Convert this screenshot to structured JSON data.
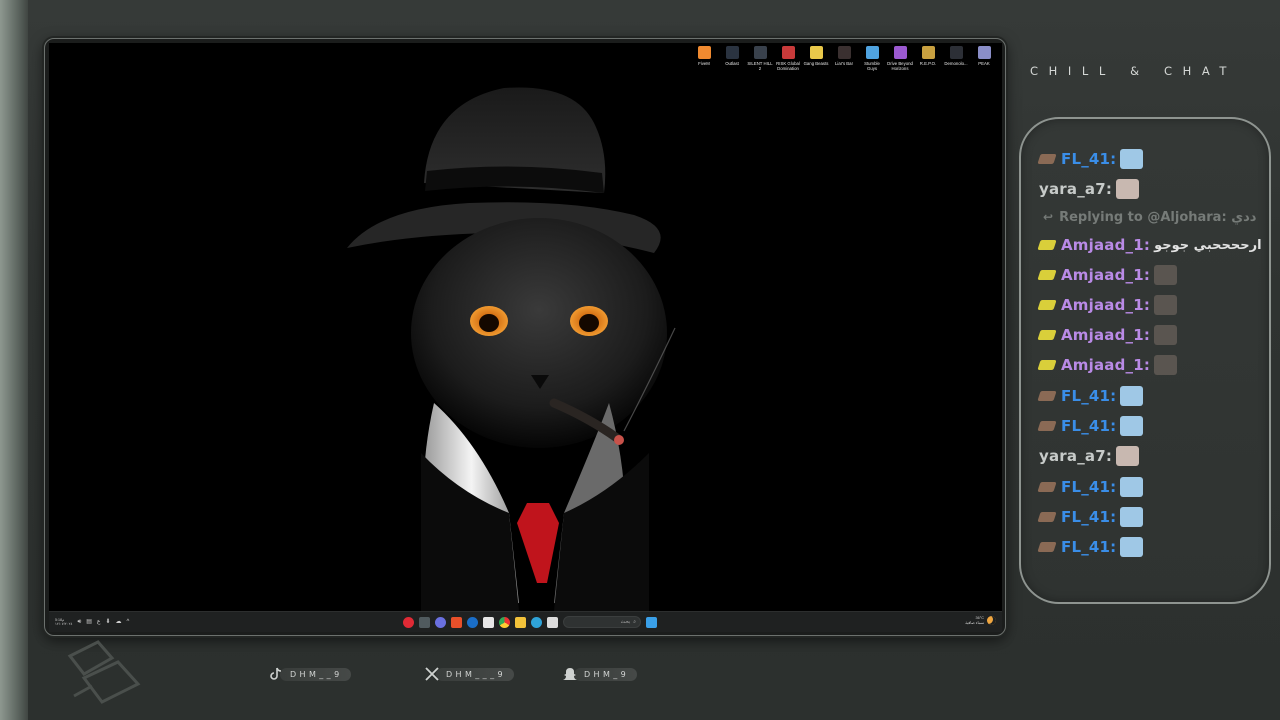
{
  "overlay": {
    "chat_title": "CHILL & CHAT"
  },
  "desktop": {
    "icons": [
      {
        "label": "FiveM",
        "icon": "fivem-icon",
        "color": "#f08a30"
      },
      {
        "label": "Outlast",
        "icon": "steam-game-icon",
        "color": "#2a3340"
      },
      {
        "label": "SILENT HILL 2",
        "icon": "steam-game-icon",
        "color": "#39414c"
      },
      {
        "label": "RISK Global Domination",
        "icon": "risk-icon",
        "color": "#c83a3a"
      },
      {
        "label": "Gang Beasts",
        "icon": "gang-beasts-icon",
        "color": "#e9c84a"
      },
      {
        "label": "Liar's Bar",
        "icon": "steam-game-icon",
        "color": "#3a3030"
      },
      {
        "label": "Stumble Guys",
        "icon": "stumble-guys-icon",
        "color": "#4fa3e0"
      },
      {
        "label": "Drive Beyond Horizons",
        "icon": "drive-icon",
        "color": "#9b59d0"
      },
      {
        "label": "R.E.P.O.",
        "icon": "repo-icon",
        "color": "#c8a040"
      },
      {
        "label": "Demonolo...",
        "icon": "steam-game-icon",
        "color": "#2c2f36"
      },
      {
        "label": "PEAK",
        "icon": "peak-icon",
        "color": "#8a8ec8"
      }
    ]
  },
  "taskbar": {
    "search_placeholder": "بحث",
    "weather_temp": "36°C",
    "weather_desc": "سماء صافية",
    "clock_time": "5:18م",
    "clock_date": "١٢/٠٧/٢٠٢٤"
  },
  "chat": {
    "messages": [
      {
        "type": "msg",
        "user": "FL_41:",
        "user_color": "#3a8ee8",
        "badge_color": "#8a6a55",
        "thumb": true,
        "thumb_color": "#9fc8e6"
      },
      {
        "type": "msg",
        "user": "yara_a7:",
        "user_color": "#c7cbc9",
        "badge_color": "",
        "thumb": true,
        "thumb_color": "#c8b8b0"
      },
      {
        "type": "reply",
        "text": "Replying to @Aljohara: ددي"
      },
      {
        "type": "msg",
        "user": "Amjaad_1:",
        "user_color": "#b98ae6",
        "badge_color": "#d9cf3a",
        "thumb": false,
        "text": "ارححححبي جوجو"
      },
      {
        "type": "msg",
        "user": "Amjaad_1:",
        "user_color": "#b98ae6",
        "badge_color": "#d9cf3a",
        "thumb": true,
        "thumb_color": "#5a5550"
      },
      {
        "type": "msg",
        "user": "Amjaad_1:",
        "user_color": "#b98ae6",
        "badge_color": "#d9cf3a",
        "thumb": true,
        "thumb_color": "#5a5550"
      },
      {
        "type": "msg",
        "user": "Amjaad_1:",
        "user_color": "#b98ae6",
        "badge_color": "#d9cf3a",
        "thumb": true,
        "thumb_color": "#5a5550"
      },
      {
        "type": "msg",
        "user": "Amjaad_1:",
        "user_color": "#b98ae6",
        "badge_color": "#d9cf3a",
        "thumb": true,
        "thumb_color": "#5a5550"
      },
      {
        "type": "msg",
        "user": "FL_41:",
        "user_color": "#3a8ee8",
        "badge_color": "#8a6a55",
        "thumb": true,
        "thumb_color": "#9fc8e6"
      },
      {
        "type": "msg",
        "user": "FL_41:",
        "user_color": "#3a8ee8",
        "badge_color": "#8a6a55",
        "thumb": true,
        "thumb_color": "#9fc8e6"
      },
      {
        "type": "msg",
        "user": "yara_a7:",
        "user_color": "#c7cbc9",
        "badge_color": "",
        "thumb": true,
        "thumb_color": "#c8b8b0"
      },
      {
        "type": "msg",
        "user": "FL_41:",
        "user_color": "#3a8ee8",
        "badge_color": "#8a6a55",
        "thumb": true,
        "thumb_color": "#9fc8e6"
      },
      {
        "type": "msg",
        "user": "FL_41:",
        "user_color": "#3a8ee8",
        "badge_color": "#8a6a55",
        "thumb": true,
        "thumb_color": "#9fc8e6"
      },
      {
        "type": "msg",
        "user": "FL_41:",
        "user_color": "#3a8ee8",
        "badge_color": "#8a6a55",
        "thumb": true,
        "thumb_color": "#9fc8e6"
      }
    ]
  },
  "socials": [
    {
      "icon": "tiktok-icon",
      "handle": "DHM__9"
    },
    {
      "icon": "x-icon",
      "handle": "DHM___9"
    },
    {
      "icon": "snapchat-icon",
      "handle": "DHM_9"
    }
  ]
}
